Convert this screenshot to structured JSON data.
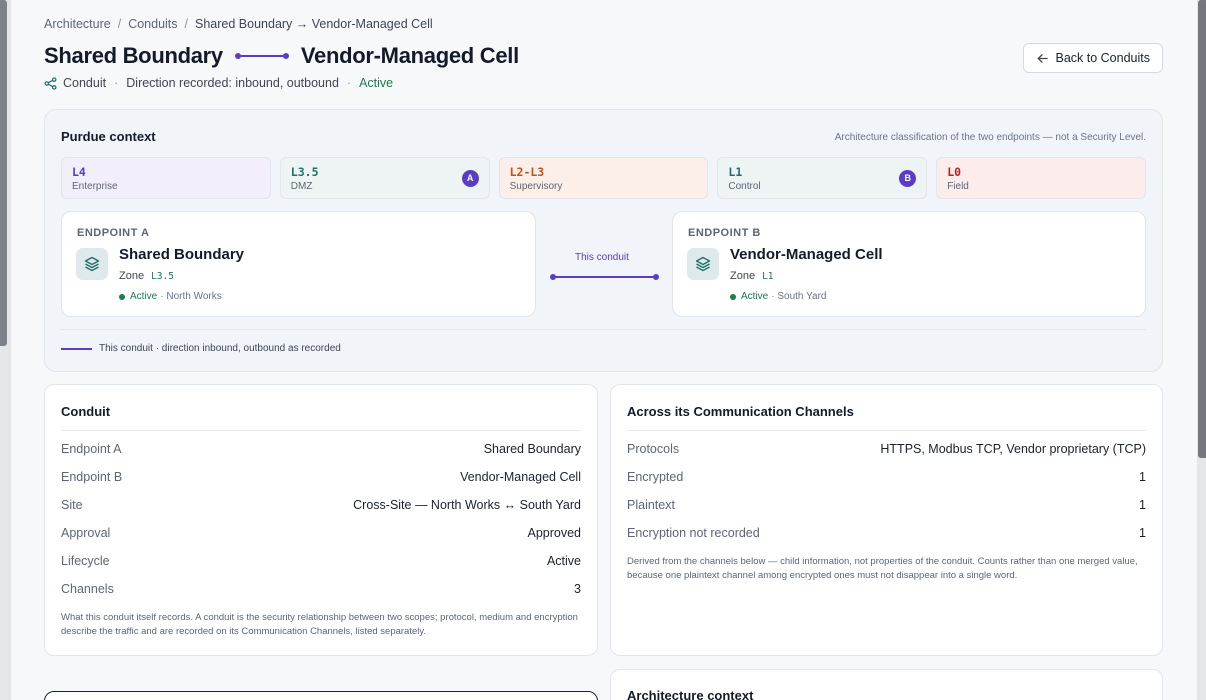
{
  "breadcrumb": {
    "items": [
      "Architecture",
      "Conduits",
      "Shared Boundary → Vendor-Managed Cell"
    ]
  },
  "header": {
    "endpoint_a": "Shared Boundary",
    "endpoint_b": "Vendor-Managed Cell",
    "type": "Conduit",
    "direction": "Direction recorded: inbound, outbound",
    "status": "Active",
    "back_label": "Back to Conduits"
  },
  "purdue": {
    "title": "Purdue context",
    "note": "Architecture classification of the two endpoints — not a Security Level.",
    "levels": [
      {
        "code": "L4",
        "name": "Enterprise",
        "badge": "",
        "bg": "#f2effa",
        "color": "#5b3cc4"
      },
      {
        "code": "L3.5",
        "name": "DMZ",
        "badge": "A",
        "bg": "#eef4f3",
        "color": "#1f6f6a"
      },
      {
        "code": "L2-L3",
        "name": "Supervisory",
        "badge": "",
        "bg": "#fcefe9",
        "color": "#c0501e"
      },
      {
        "code": "L1",
        "name": "Control",
        "badge": "B",
        "bg": "#eef4f3",
        "color": "#1f6f6a"
      },
      {
        "code": "L0",
        "name": "Field",
        "badge": "",
        "bg": "#fcecec",
        "color": "#b42323"
      }
    ],
    "endpoint_a": {
      "kicker": "ENDPOINT A",
      "name": "Shared Boundary",
      "zone_label": "Zone",
      "zone_code": "L3.5",
      "status": "Active",
      "site": "· North Works"
    },
    "endpoint_b": {
      "kicker": "ENDPOINT B",
      "name": "Vendor-Managed Cell",
      "zone_label": "Zone",
      "zone_code": "L1",
      "status": "Active",
      "site": "· South Yard"
    },
    "connector_label": "This conduit",
    "legend": "This conduit · direction inbound, outbound as recorded"
  },
  "conduit_card": {
    "title": "Conduit",
    "rows": [
      {
        "k": "Endpoint A",
        "v": "Shared Boundary"
      },
      {
        "k": "Endpoint B",
        "v": "Vendor-Managed Cell"
      },
      {
        "k": "Site",
        "v": "Cross-Site — North Works ↔ South Yard"
      },
      {
        "k": "Approval",
        "v": "Approved"
      },
      {
        "k": "Lifecycle",
        "v": "Active"
      },
      {
        "k": "Channels",
        "v": "3"
      }
    ],
    "footnote": "What this conduit itself records. A conduit is the security relationship between two scopes; protocol, medium and encryption describe the traffic and are recorded on its Communication Channels, listed separately."
  },
  "channels_card": {
    "title": "Across its Communication Channels",
    "rows": [
      {
        "k": "Protocols",
        "v": "HTTPS, Modbus TCP, Vendor proprietary (TCP)"
      },
      {
        "k": "Encrypted",
        "v": "1"
      },
      {
        "k": "Plaintext",
        "v": "1"
      },
      {
        "k": "Encryption not recorded",
        "v": "1"
      }
    ],
    "footnote": "Derived from the channels below — child information, not properties of the conduit. Counts rather than one merged value, because one plaintext channel among encrypted ones must not disappear into a single word."
  },
  "architecture_card": {
    "title": "Architecture context"
  },
  "colors": {
    "accent": "#5b3cc4",
    "active": "#1f7a4f",
    "teal": "#1f6f6a"
  },
  "icons": [
    "share-icon",
    "arrow-left-icon",
    "layers-icon"
  ]
}
